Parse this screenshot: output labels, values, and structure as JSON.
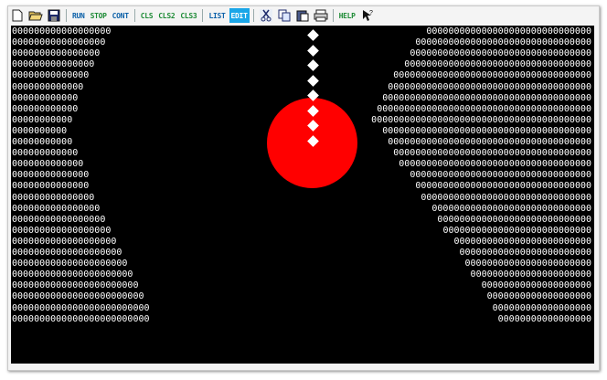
{
  "toolbar": {
    "icons": [
      "new-file-icon",
      "open-folder-icon",
      "save-disk-icon"
    ],
    "run": "RUN",
    "stop": "STOP",
    "cont": "CONT",
    "cls": "CLS",
    "cls2": "CLS2",
    "cls3": "CLS3",
    "list": "LIST",
    "edit": "EDIT",
    "help": "HELP",
    "icons2": [
      "cut-scissors-icon",
      "copy-icon",
      "paste-icon",
      "print-icon",
      "help-pointer-icon"
    ]
  },
  "screen": {
    "rows": [
      {
        "left": "000000000000000000",
        "right": "000000000000000000000000000000"
      },
      {
        "left": "00000000000000000",
        "right": "00000000000000000000000000000000"
      },
      {
        "left": "0000000000000000",
        "right": "000000000000000000000000000000000"
      },
      {
        "left": "000000000000000",
        "right": "0000000000000000000000000000000000"
      },
      {
        "left": "00000000000000",
        "right": "000000000000000000000000000000000000"
      },
      {
        "left": "0000000000000",
        "right": "0000000000000000000000000000000000000"
      },
      {
        "left": "000000000000",
        "right": "00000000000000000000000000000000000000"
      },
      {
        "left": "000000000000",
        "right": "000000000000000000000000000000000000000"
      },
      {
        "left": "00000000000",
        "right": "0000000000000000000000000000000000000000"
      },
      {
        "left": "0000000000",
        "right": "00000000000000000000000000000000000000"
      },
      {
        "left": "00000000000",
        "right": "0000000000000000000000000000000000000"
      },
      {
        "left": "000000000000",
        "right": "000000000000000000000000000000000000"
      },
      {
        "left": "0000000000000",
        "right": "00000000000000000000000000000000000"
      },
      {
        "left": "00000000000000",
        "right": "000000000000000000000000000000000"
      },
      {
        "left": "00000000000000",
        "right": "00000000000000000000000000000000"
      },
      {
        "left": "000000000000000",
        "right": "0000000000000000000000000000000"
      },
      {
        "left": "0000000000000000",
        "right": "00000000000000000000000000000"
      },
      {
        "left": "00000000000000000",
        "right": "0000000000000000000000000000"
      },
      {
        "left": "000000000000000000",
        "right": "000000000000000000000000000"
      },
      {
        "left": "0000000000000000000",
        "right": "0000000000000000000000000"
      },
      {
        "left": "00000000000000000000",
        "right": "000000000000000000000000"
      },
      {
        "left": "000000000000000000000",
        "right": "00000000000000000000000"
      },
      {
        "left": "0000000000000000000000",
        "right": "0000000000000000000000"
      },
      {
        "left": "00000000000000000000000",
        "right": "00000000000000000000"
      },
      {
        "left": "000000000000000000000000",
        "right": "0000000000000000000"
      },
      {
        "left": "0000000000000000000000000",
        "right": "000000000000000000"
      },
      {
        "left": "0000000000000000000000000",
        "right": "00000000000000000"
      }
    ],
    "ball_color": "#ff0000",
    "background_color": "#000000",
    "text_color": "#ffffff"
  }
}
